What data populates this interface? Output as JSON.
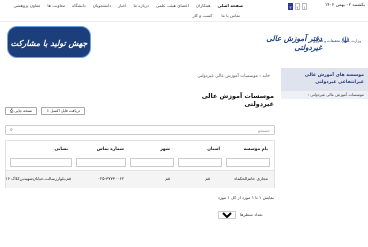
{
  "topbar": {
    "date": "یکشنبه ۰۲ بهمن ۱۴۰۲",
    "pages": [
      "۳",
      "۲",
      "۱"
    ],
    "nav": [
      "صفحه اصلی",
      "همکاران",
      "اعضای هیئت علمی",
      "درباره ما",
      "اخبار",
      "دانشجویان",
      "دانشگاه",
      "معاونت ها",
      "معاون پژوهشی"
    ],
    "subnav": [
      "تماس با ما",
      "کسب و کار"
    ]
  },
  "banner": {
    "slogan": "جهش تولید با مشارکت مردم",
    "title": "دفتر آموزش عالی غیردولتی",
    "ministry": "وزارت علوم، تحقیقات و فناوری",
    "emblem": "☫"
  },
  "sidebar": {
    "title": "موسسه های آموزش عالی غیرانتفاعی غیردولتی",
    "sub": "‹ موسسات آموزش عالی غیردولتی"
  },
  "breadcrumb": "خانه › موسسات آموزش عالی غیردولتی",
  "page_title": "موسسات آموزش عالی غیردولتی",
  "actions": {
    "download": "⇩ دریافت فایل اکسل",
    "print": "⎙ نسخه چاپی"
  },
  "search": {
    "placeholder": "جستجو"
  },
  "table": {
    "headers": [
      "نام موسسه",
      "استان",
      "شهر",
      "شماره تماس",
      "نشانی"
    ],
    "row": {
      "name": "مجازی خاتم‌الحکماء",
      "province": "قم",
      "city": "قم",
      "phone": "۰۲۵-۳۷۷۳۰۰۶۲",
      "address": "قم،بلوار‌رسالت،خیابان‌شهیدبن‌کلاک ۱۶"
    }
  },
  "paging": {
    "info": "نمایش ۱ تا ۱ مورد از کل ۱ مورد",
    "size_label": "تعداد سطرها",
    "size_value": "۱۰"
  }
}
